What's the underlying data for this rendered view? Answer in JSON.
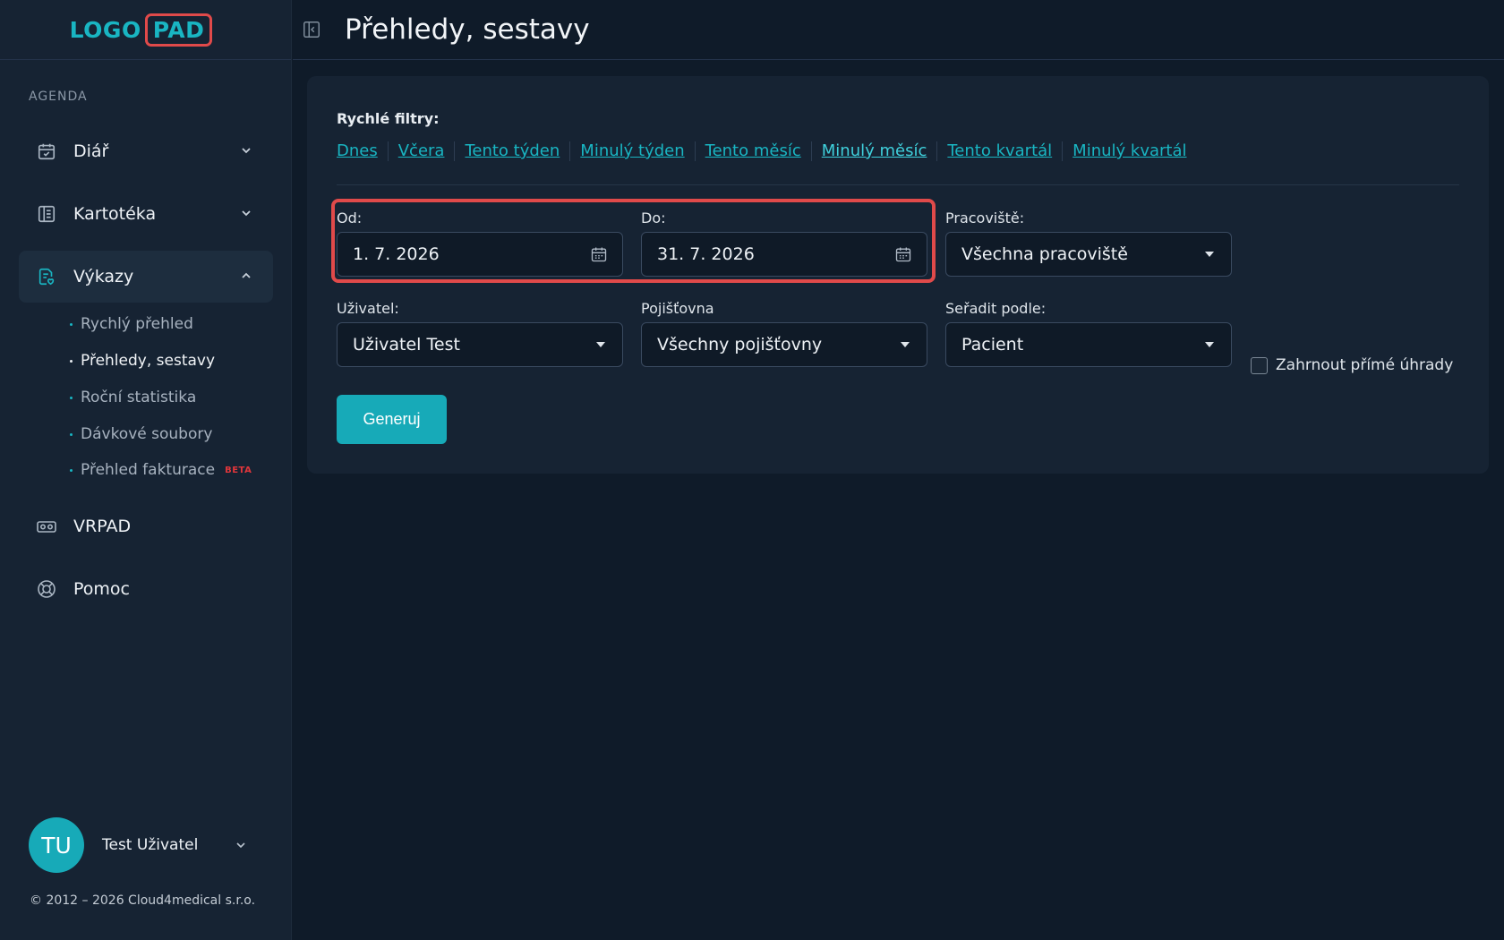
{
  "logo": {
    "part1": "LOGO",
    "part2": "PAD"
  },
  "sidebar": {
    "section_label": "AGENDA",
    "items": [
      {
        "label": "Diář",
        "icon": "calendar-check-icon"
      },
      {
        "label": "Kartotéka",
        "icon": "book-icon"
      },
      {
        "label": "Výkazy",
        "icon": "report-icon",
        "expanded": true
      },
      {
        "label": "VRPAD",
        "icon": "vr-headset-icon"
      },
      {
        "label": "Pomoc",
        "icon": "lifebuoy-icon"
      }
    ],
    "subitems": [
      {
        "label": "Rychlý přehled"
      },
      {
        "label": "Přehledy, sestavy",
        "active": true
      },
      {
        "label": "Roční statistika"
      },
      {
        "label": "Dávkové soubory"
      },
      {
        "label": "Přehled fakturace",
        "badge": "BETA"
      }
    ]
  },
  "user": {
    "initials": "TU",
    "name": "Test Uživatel"
  },
  "footer": {
    "copyright": "© 2012 – 2026 Cloud4medical s.r.o."
  },
  "header": {
    "title": "Přehledy, sestavy"
  },
  "filters": {
    "quick_label": "Rychlé filtry:",
    "quick": [
      "Dnes",
      "Včera",
      "Tento týden",
      "Minulý týden",
      "Tento měsíc",
      "Minulý měsíc",
      "Tento kvartál",
      "Minulý kvartál"
    ],
    "from_label": "Od:",
    "from_value": "1. 7. 2026",
    "to_label": "Do:",
    "to_value": "31. 7. 2026",
    "workplace_label": "Pracoviště:",
    "workplace_value": "Všechna pracoviště",
    "user_label": "Uživatel:",
    "user_value": "Uživatel Test",
    "insurance_label": "Pojišťovna",
    "insurance_value": "Všechny pojišťovny",
    "sort_label": "Seřadit podle:",
    "sort_value": "Pacient",
    "direct_payments_label": "Zahrnout přímé úhrady",
    "generate_label": "Generuj"
  },
  "colors": {
    "accent": "#17aab8",
    "highlight": "#e04a4a",
    "beta": "#e0363b"
  }
}
